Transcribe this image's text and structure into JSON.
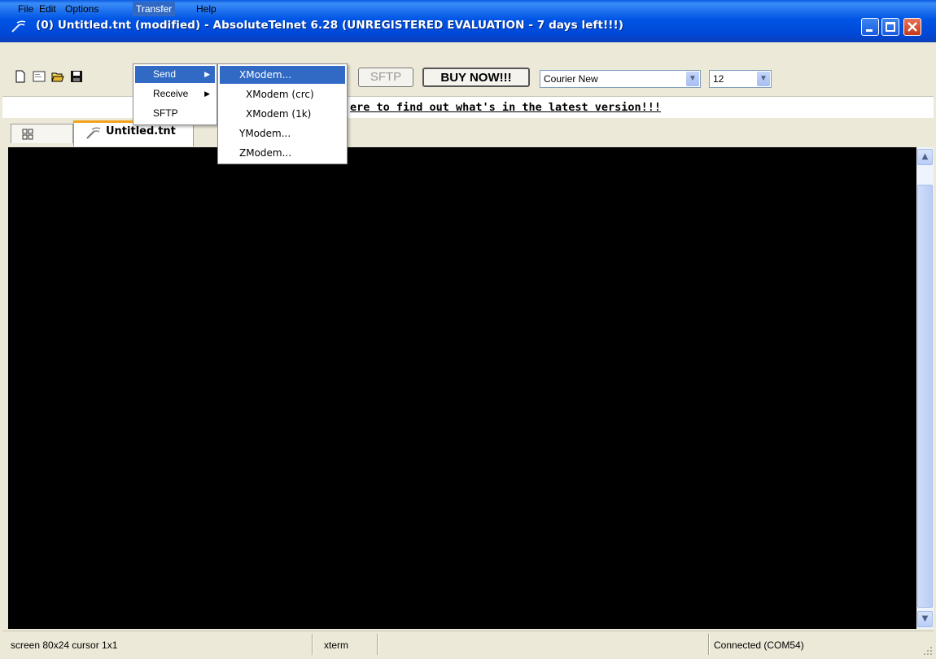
{
  "window": {
    "title": "(0) Untitled.tnt (modified) - AbsoluteTelnet 6.28   (UNREGISTERED EVALUATION - 7 days left!!!)"
  },
  "menubar": {
    "items": [
      "File",
      "Edit",
      "Options",
      "Transfer",
      "Help"
    ],
    "active": "Transfer"
  },
  "transfer_menu": {
    "items": [
      {
        "label": "Send",
        "has_submenu": true
      },
      {
        "label": "Receive",
        "has_submenu": true
      },
      {
        "label": "SFTP",
        "has_submenu": false
      }
    ]
  },
  "send_submenu": {
    "items": [
      "XModem...",
      "XModem (crc)",
      "XModem (1k)",
      "YModem...",
      "ZModem..."
    ]
  },
  "toolbar": {
    "sftp_label": "SFTP",
    "buy_label": "BUY NOW!!!",
    "font_name": "Courier New",
    "font_size": "12",
    "icons": [
      "new-document-icon",
      "properties-icon",
      "open-folder-icon",
      "save-disk-icon"
    ]
  },
  "info": {
    "link_text": "ere to find out what's in the latest version!!!"
  },
  "tabs": {
    "active_label": "Untitled.tnt"
  },
  "statusbar": {
    "screen": "screen 80x24 cursor 1x1",
    "terminal_type": "xterm",
    "connection": "Connected (COM54)"
  },
  "colors": {
    "titlebar": "#0055e5",
    "menu_highlight": "#316ac5",
    "terminal_bg": "#000000",
    "tab_accent": "#f2a21b"
  }
}
